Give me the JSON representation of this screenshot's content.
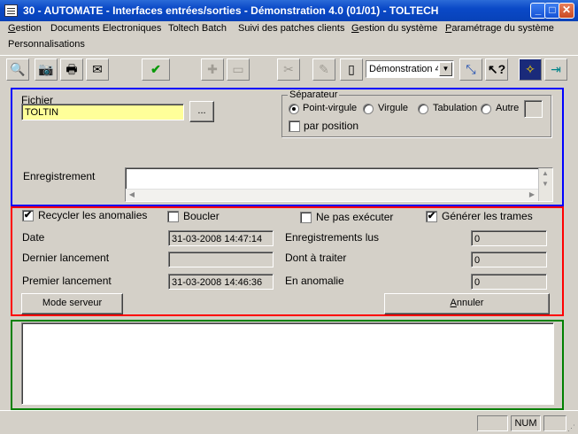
{
  "window": {
    "title": "30 - AUTOMATE - Interfaces entrées/sorties - Démonstration 4.0 (01/01) - TOLTECH",
    "minimize": "_",
    "maximize": "□",
    "close": "✕"
  },
  "menu": {
    "gestion": {
      "acc": "G",
      "rest": "estion"
    },
    "documents": "Documents Electroniques",
    "toltech_batch": "Toltech Batch",
    "suivi": "Suivi des patches clients",
    "systeme": {
      "acc": "G",
      "rest": "estion du système"
    },
    "parametrage": {
      "acc": "P",
      "rest": "aramétrage du système"
    },
    "personnalisations": "Personnalisations"
  },
  "toolbar": {
    "combo_value": "Démonstration 4"
  },
  "fichier": {
    "label": "Fichier",
    "value": "TOLTIN",
    "browse": "..."
  },
  "separateur": {
    "legend": "Séparateur",
    "options": [
      "Point-virgule",
      "Virgule",
      "Tabulation",
      "Autre"
    ],
    "selected": "Point-virgule",
    "par_position": "par position"
  },
  "enregistrement": {
    "label": "Enregistrement"
  },
  "options": {
    "recycler": "Recycler les anomalies",
    "boucler": "Boucler",
    "ne_pas_executer": "Ne pas exécuter",
    "generer": "Générer les trames",
    "check_mark": "✔"
  },
  "stats": {
    "date_label": "Date",
    "date_value": "31-03-2008 14:47:14",
    "dernier_label": "Dernier lancement",
    "dernier_value": "",
    "premier_label": "Premier lancement",
    "premier_value": "31-03-2008 14:46:36",
    "lus_label": "Enregistrements lus",
    "lus_value": "0",
    "traiter_label": "Dont à traiter",
    "traiter_value": "0",
    "anomalie_label": "En anomalie",
    "anomalie_value": "0"
  },
  "buttons": {
    "mode_serveur": "Mode serveur",
    "annuler": {
      "acc": "A",
      "rest": "nnuler"
    }
  },
  "statusbar": {
    "num": "NUM"
  }
}
